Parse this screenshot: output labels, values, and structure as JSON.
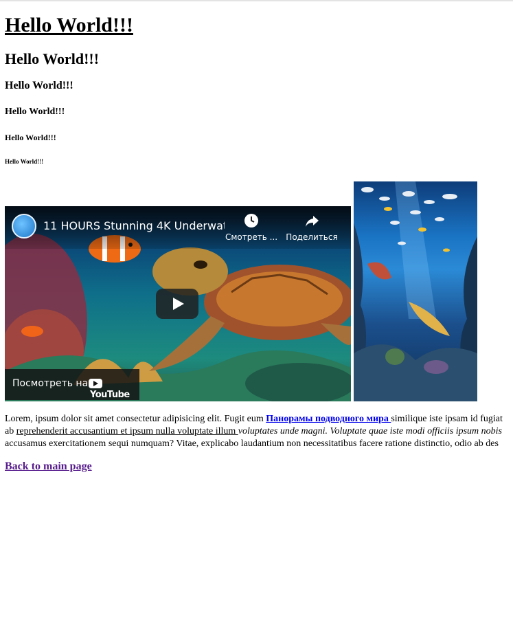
{
  "headings": {
    "h1": "Hello World!!!",
    "h2": "Hello World!!!",
    "h3": "Hello World!!!",
    "h4": "Hello World!!!",
    "h5": "Hello World!!!",
    "h6": "Hello World!!!"
  },
  "video": {
    "title": "11 HOURS Stunning 4K Underwate...",
    "watch_later_label": "Смотреть ...",
    "share_label": "Поделиться",
    "watch_on_label": "Посмотреть на",
    "platform_label": "YouTube",
    "icons": [
      "channel-avatar-icon",
      "clock-icon",
      "share-arrow-icon",
      "play-icon",
      "youtube-logo-icon"
    ]
  },
  "side_image": {
    "alt": ""
  },
  "paragraph": {
    "line1_text": "Lorem, ipsum dolor sit amet consectetur adipisicing elit. Fugit eum ",
    "link_text": "Панорамы подводного мира ",
    "line1_after": "similique iste ipsam id fugiat",
    "line2_start": "ab ",
    "underlined_text": "reprehenderit accusantium et ipsum nulla voluptate illum ",
    "italic_text": "voluptates unde magni. Voluptate quae iste modi officiis ipsum nobis",
    "line3_text": "accusamus exercitationem sequi numquam? Vitae, explicabo laudantium non necessitatibus facere ratione distinctio, odio ab des"
  },
  "back_link": "Back to main page",
  "colors": {
    "link": "#0000ee",
    "visited_link": "#551a8b"
  }
}
